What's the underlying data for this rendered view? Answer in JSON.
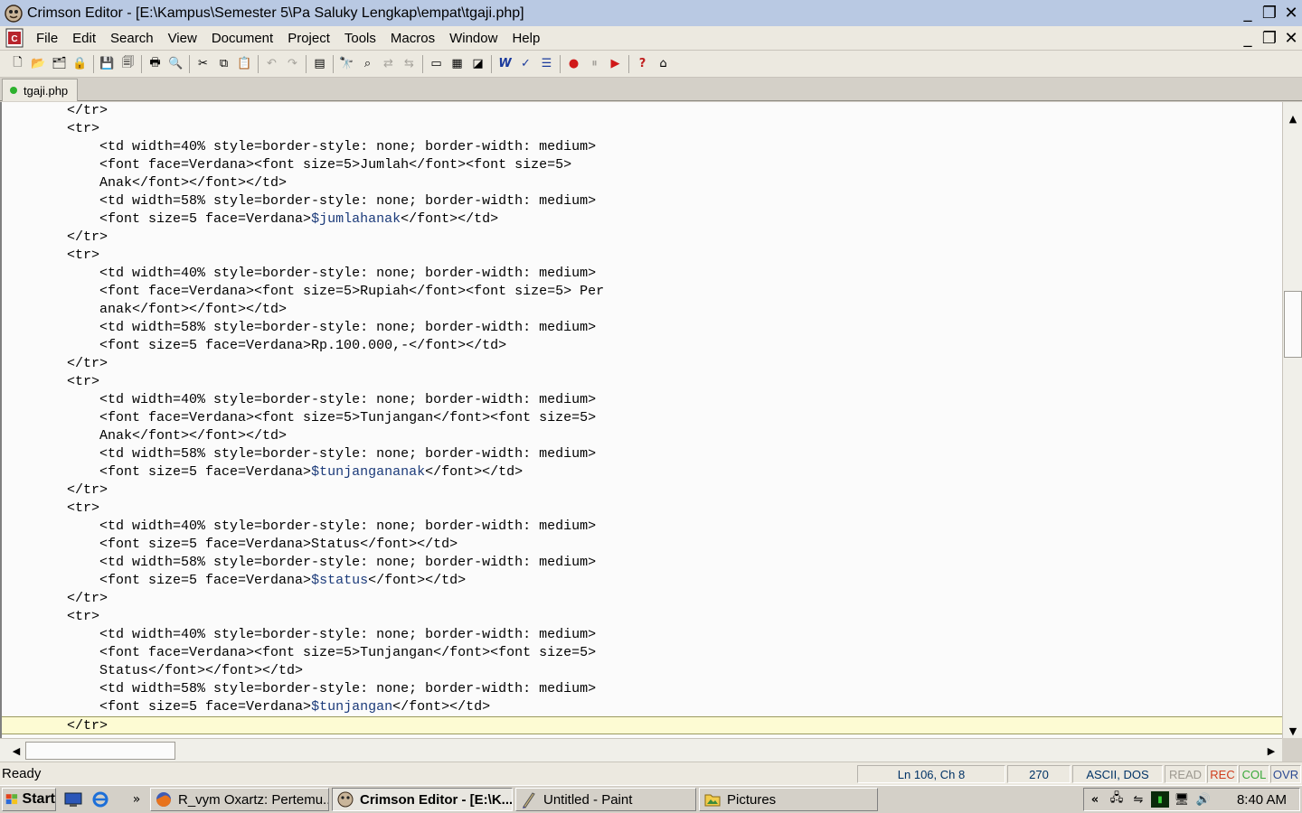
{
  "window": {
    "title": "Crimson Editor - [E:\\Kampus\\Semester 5\\Pa Saluky Lengkap\\empat\\tgaji.php]",
    "min_glyph": "_",
    "restore_glyph": "❐",
    "close_glyph": "✕"
  },
  "menu": [
    "File",
    "Edit",
    "Search",
    "View",
    "Document",
    "Project",
    "Tools",
    "Macros",
    "Window",
    "Help"
  ],
  "tab": {
    "label": "tgaji.php"
  },
  "code_lines": [
    "        </tr>",
    "        <tr>",
    "            <td width=40% style=border-style: none; border-width: medium>",
    "            <font face=Verdana><font size=5>Jumlah</font><font size=5>",
    "            Anak</font></font></td>",
    "            <td width=58% style=border-style: none; border-width: medium>",
    "            <font size=5 face=Verdana>$jumlahanak</font></td>",
    "        </tr>",
    "        <tr>",
    "            <td width=40% style=border-style: none; border-width: medium>",
    "            <font face=Verdana><font size=5>Rupiah</font><font size=5> Per",
    "            anak</font></font></td>",
    "            <td width=58% style=border-style: none; border-width: medium>",
    "            <font size=5 face=Verdana>Rp.100.000,-</font></td>",
    "        </tr>",
    "        <tr>",
    "            <td width=40% style=border-style: none; border-width: medium>",
    "            <font face=Verdana><font size=5>Tunjangan</font><font size=5>",
    "            Anak</font></font></td>",
    "            <td width=58% style=border-style: none; border-width: medium>",
    "            <font size=5 face=Verdana>$tunjangananak</font></td>",
    "        </tr>",
    "        <tr>",
    "            <td width=40% style=border-style: none; border-width: medium>",
    "            <font size=5 face=Verdana>Status</font></td>",
    "            <td width=58% style=border-style: none; border-width: medium>",
    "            <font size=5 face=Verdana>$status</font></td>",
    "        </tr>",
    "        <tr>",
    "            <td width=40% style=border-style: none; border-width: medium>",
    "            <font face=Verdana><font size=5>Tunjangan</font><font size=5>",
    "            Status</font></font></td>",
    "            <td width=58% style=border-style: none; border-width: medium>",
    "            <font size=5 face=Verdana>$tunjangan</font></td>",
    "        </tr>"
  ],
  "current_line_index": 34,
  "variables": [
    "$jumlahanak",
    "$tunjangananak",
    "$status",
    "$tunjangan"
  ],
  "scroll": {
    "vertical_position": 0.32
  },
  "status": {
    "ready": "Ready",
    "position": "Ln 106, Ch 8",
    "count": "270",
    "encoding": "ASCII, DOS",
    "read": "READ",
    "rec": "REC",
    "col": "COL",
    "ovr": "OVR"
  },
  "taskbar": {
    "start": "Start",
    "chevron": "»",
    "tasks": [
      {
        "label": "R_vym Oxartz: Pertemu...",
        "icon": "firefox-icon"
      },
      {
        "label": "Crimson Editor - [E:\\K...",
        "icon": "crimson-editor-icon",
        "active": true
      },
      {
        "label": "Untitled - Paint",
        "icon": "paint-icon"
      },
      {
        "label": "Pictures",
        "icon": "folder-icon"
      }
    ],
    "tray_chevron": "«",
    "clock": "8:40 AM"
  },
  "colors": {
    "variable": "#1c3b7a",
    "current_line": "#fdfbd3",
    "titlebar": "#b9c9e3",
    "rec": "#d03d1d",
    "col": "#3aa93a"
  }
}
